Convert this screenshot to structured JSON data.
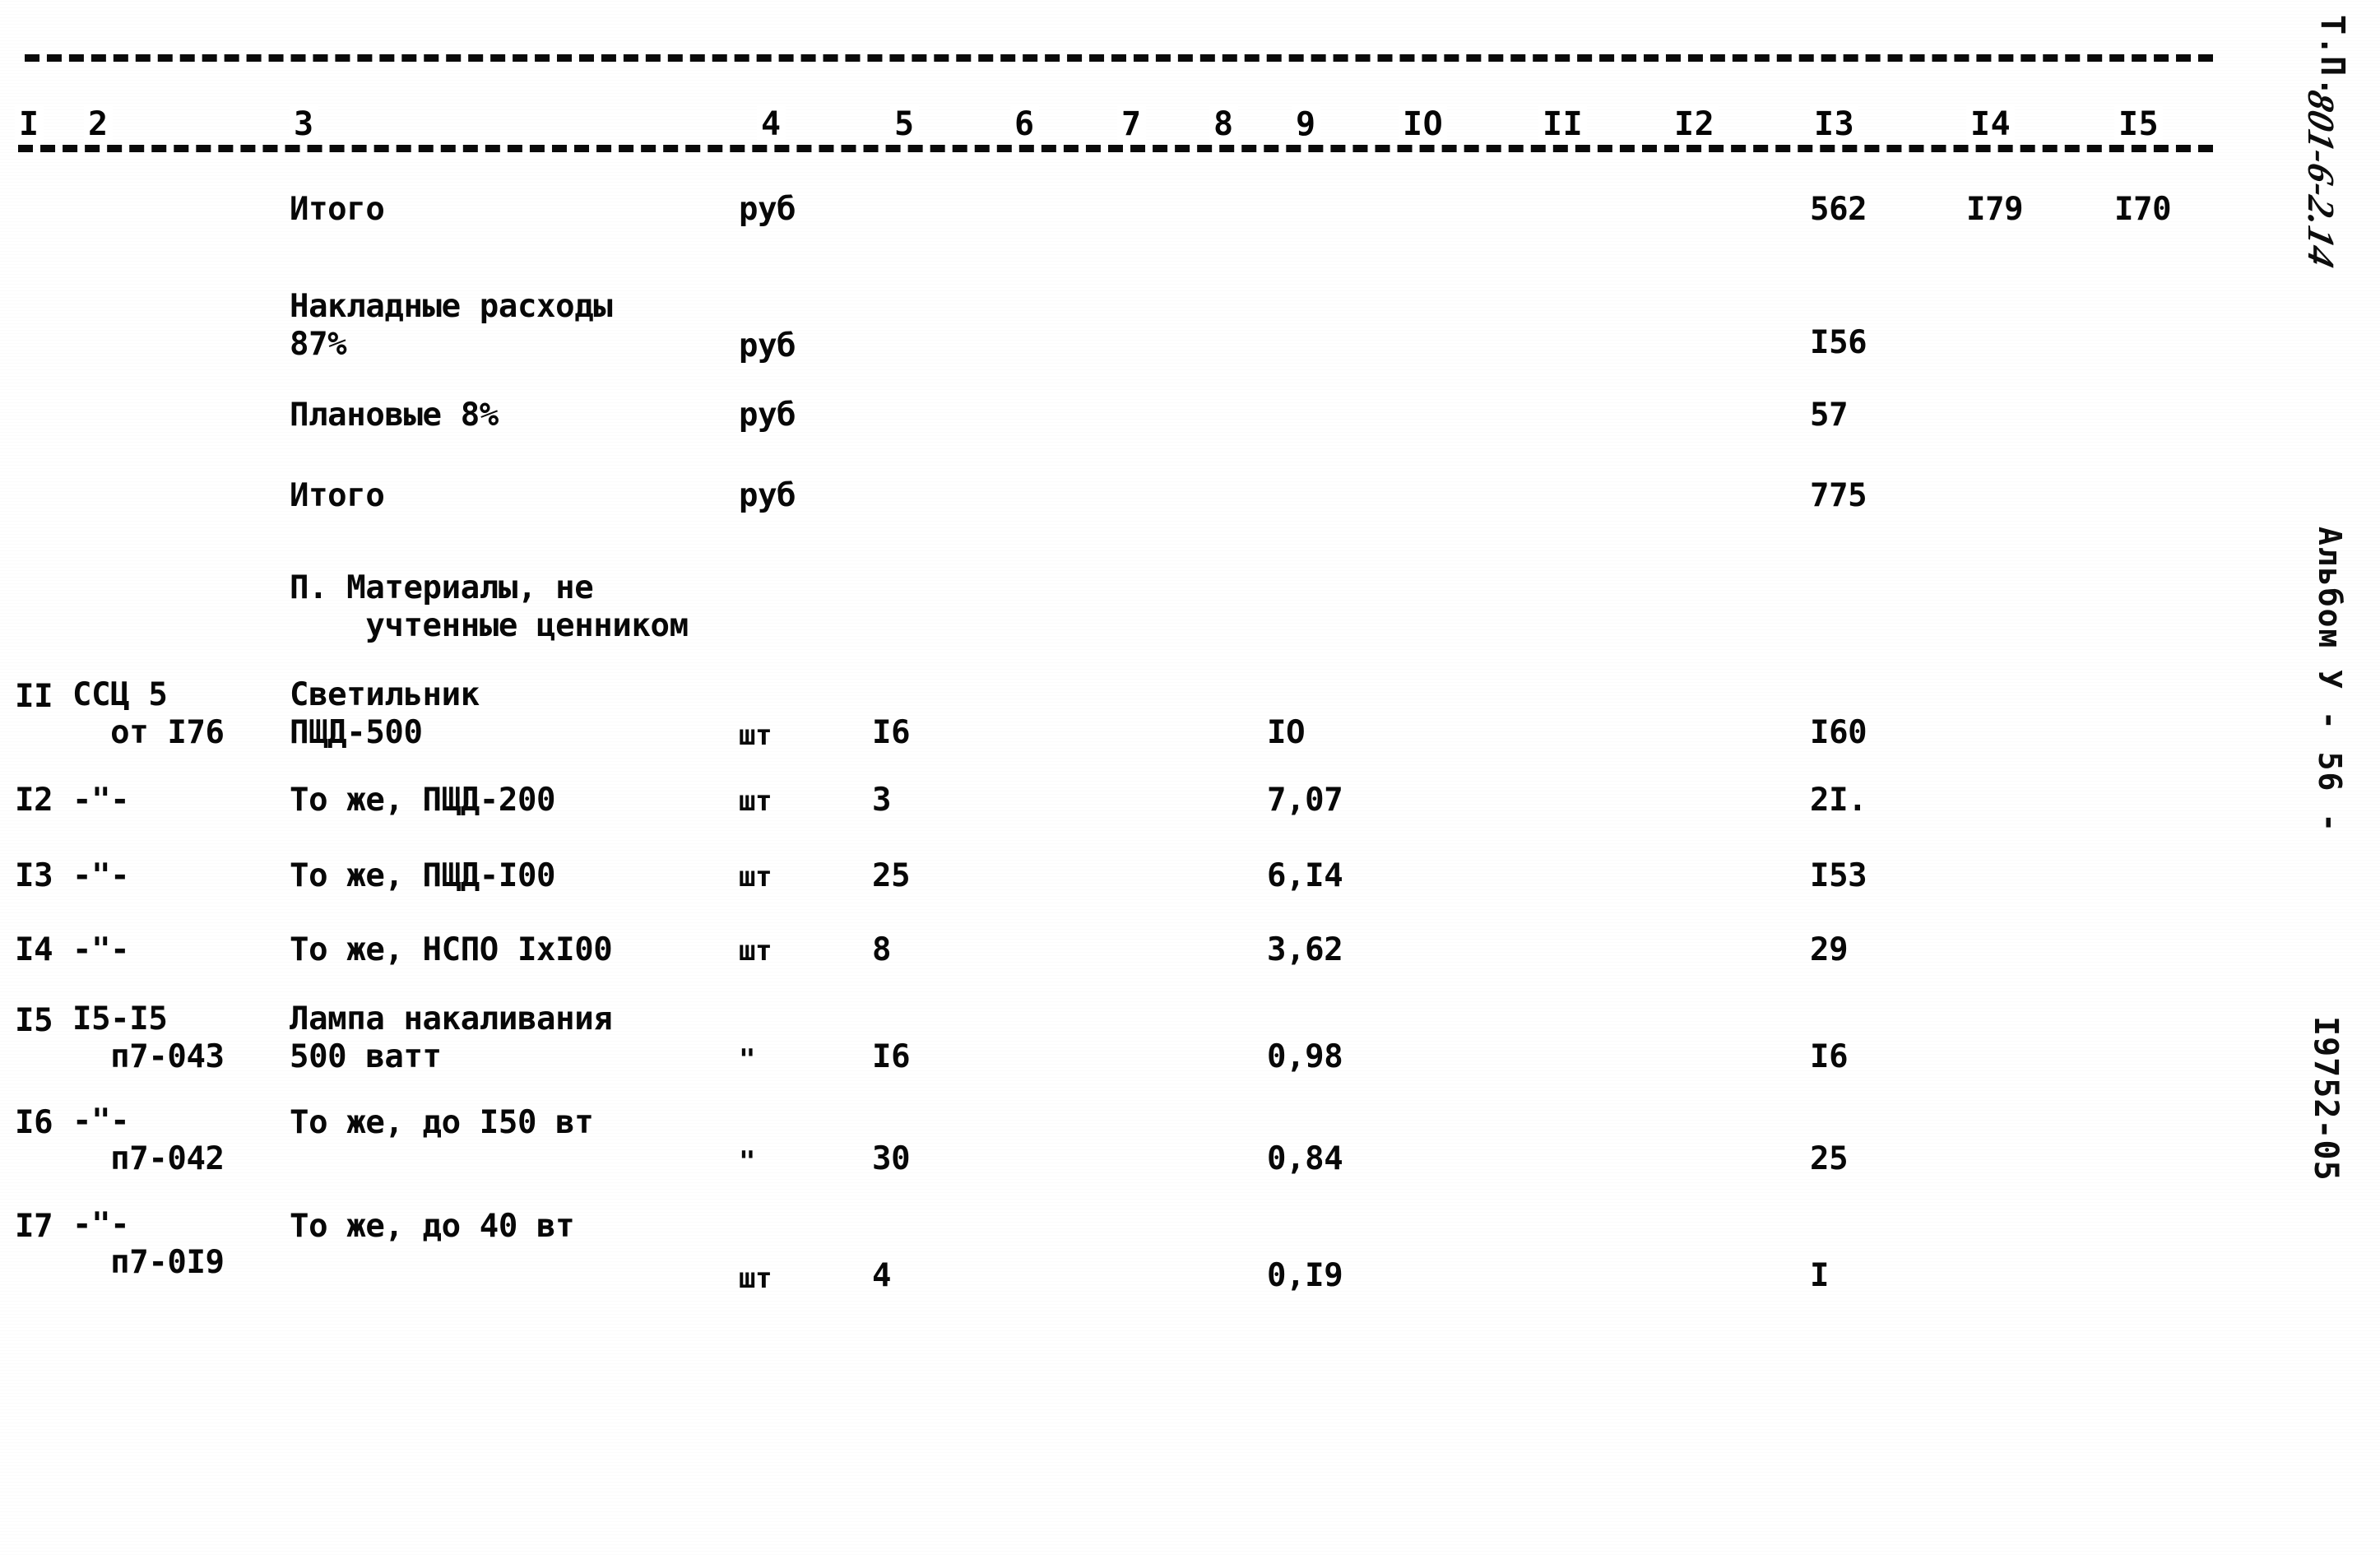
{
  "document": {
    "column_headers": [
      "I",
      "2",
      "3",
      "4",
      "5",
      "6",
      "7",
      "8",
      "9",
      "IO",
      "II",
      "I2",
      "I3",
      "I4",
      "I5"
    ],
    "section_heading": "П. Материалы, не\n    учтенные ценником"
  },
  "rows": [
    {
      "pos": "",
      "code": "",
      "name": "Итого",
      "unit": "руб",
      "qty": "",
      "price": "",
      "sum13": "562",
      "sum14": "I79",
      "sum15": "I70"
    },
    {
      "pos": "",
      "code": "",
      "name": "Накладные расходы\n87%",
      "unit": "руб",
      "qty": "",
      "price": "",
      "sum13": "I56",
      "sum14": "",
      "sum15": ""
    },
    {
      "pos": "",
      "code": "",
      "name": "Плановые 8%",
      "unit": "руб",
      "qty": "",
      "price": "",
      "sum13": "57",
      "sum14": "",
      "sum15": ""
    },
    {
      "pos": "",
      "code": "",
      "name": "Итого",
      "unit": "руб",
      "qty": "",
      "price": "",
      "sum13": "775",
      "sum14": "",
      "sum15": ""
    },
    {
      "pos": "II",
      "code": "ССЦ 5\n  от I76",
      "name": "Светильник\nПЩД-500",
      "unit": "шт",
      "qty": "I6",
      "price": "IO",
      "sum13": "I60",
      "sum14": "",
      "sum15": ""
    },
    {
      "pos": "I2",
      "code": "-\"-",
      "name": "То же, ПЩД-200",
      "unit": "шт",
      "qty": "3",
      "price": "7,07",
      "sum13": "2I.",
      "sum14": "",
      "sum15": ""
    },
    {
      "pos": "I3",
      "code": "-\"-",
      "name": "То же, ПЩД-I00",
      "unit": "шт",
      "qty": "25",
      "price": "6,I4",
      "sum13": "I53",
      "sum14": "",
      "sum15": ""
    },
    {
      "pos": "I4",
      "code": "-\"-",
      "name": "То же, НСПО IxI00",
      "unit": "шт",
      "qty": "8",
      "price": "3,62",
      "sum13": "29",
      "sum14": "",
      "sum15": ""
    },
    {
      "pos": "I5",
      "code": "I5-I5\n  п7-043",
      "name": "Лампа накаливания\n500 ватт",
      "unit": "\"",
      "qty": "I6",
      "price": "0,98",
      "sum13": "I6",
      "sum14": "",
      "sum15": ""
    },
    {
      "pos": "I6",
      "code": "-\"-\n  п7-042",
      "name": "То же, до I50 вт",
      "unit": "\"",
      "qty": "30",
      "price": "0,84",
      "sum13": "25",
      "sum14": "",
      "sum15": ""
    },
    {
      "pos": "I7",
      "code": "-\"-\n  п7-0I9",
      "name": "То же, до 40 вт",
      "unit": "шт",
      "qty": "4",
      "price": "0,I9",
      "sum13": "I",
      "sum14": "",
      "sum15": ""
    }
  ],
  "margin": {
    "type_designation": "Т.П.",
    "handwritten_code": "801-6-2.14",
    "album": "Альбом У - 56 -",
    "doc_number": "I9752-05"
  }
}
